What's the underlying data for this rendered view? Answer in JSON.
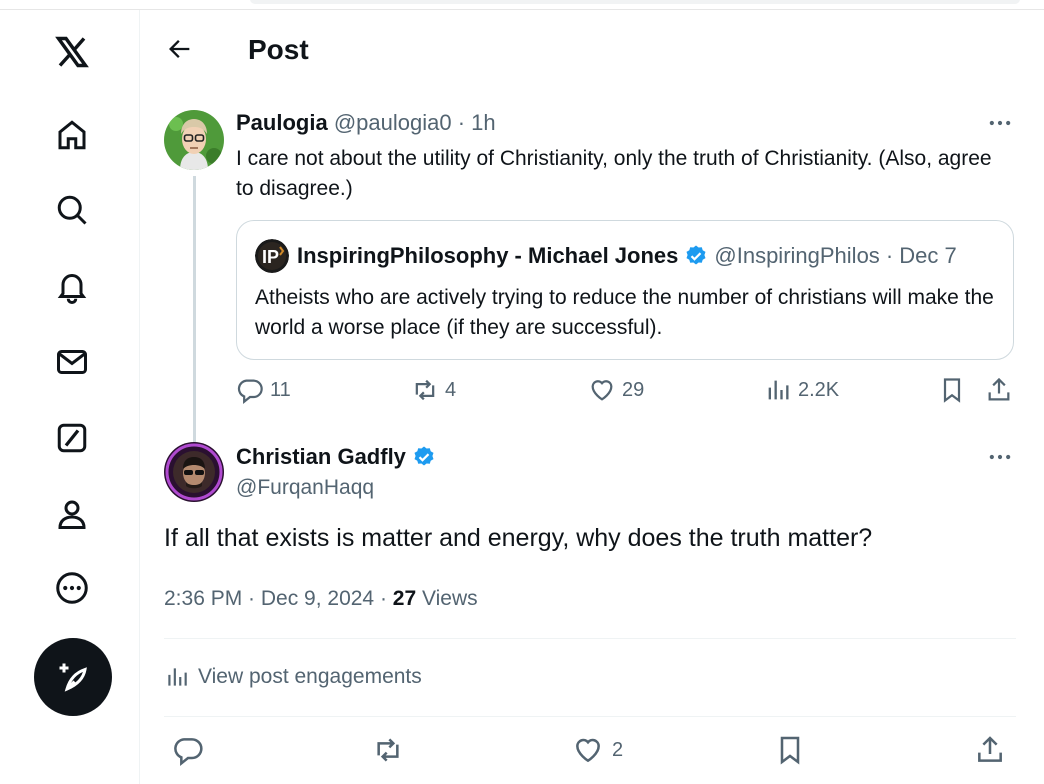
{
  "header": {
    "title": "Post"
  },
  "sidebar": {
    "items": [
      {
        "icon": "x-logo-icon"
      },
      {
        "icon": "home-icon"
      },
      {
        "icon": "search-icon"
      },
      {
        "icon": "bell-icon"
      },
      {
        "icon": "mail-icon"
      },
      {
        "icon": "grok-icon"
      },
      {
        "icon": "profile-icon"
      },
      {
        "icon": "more-circle-icon"
      },
      {
        "icon": "compose-icon"
      }
    ]
  },
  "reply": {
    "name": "Paulogia",
    "handle": "@paulogia0",
    "time": "· 1h",
    "text": "I care not about the utility of Christianity, only the truth of Christianity. (Also, agree to disagree.)",
    "quote": {
      "name": "InspiringPhilosophy - Michael Jones",
      "handle": "@InspiringPhilos",
      "time": "· Dec 7",
      "text": "Atheists who are actively trying to reduce the number of christians will make the world a worse place (if they are successful)."
    },
    "actions": {
      "replies": "11",
      "reposts": "4",
      "likes": "29",
      "views": "2.2K"
    }
  },
  "post": {
    "name": "Christian Gadfly",
    "handle": "@FurqanHaqq",
    "text": "If all that exists is matter and energy, why does the truth matter?",
    "timestamp": "2:36 PM · Dec 9, 2024 · ",
    "views_count": "27",
    "views_label": " Views",
    "engagements_label": "View post engagements",
    "likes": "2"
  },
  "colors": {
    "verified": "#1d9bf0",
    "muted": "#536471",
    "text": "#0f1419"
  }
}
